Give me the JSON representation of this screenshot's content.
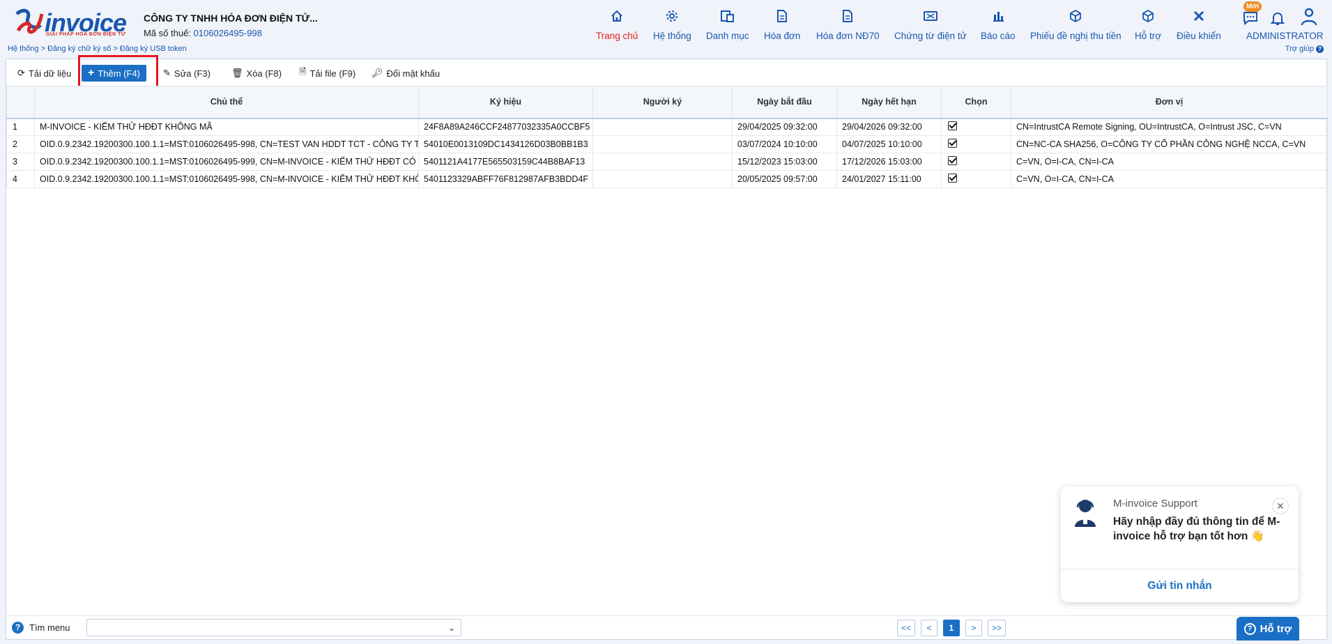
{
  "header": {
    "logo_text": "invoice",
    "logo_sub": "GIẢI PHÁP HÓA ĐƠN ĐIỆN TỬ",
    "company": "CÔNG TY TNHH HÓA ĐƠN ĐIỆN TỬ...",
    "tax_label": "Mã số thuế:",
    "tax_value": "0106026495-998",
    "breadcrumb": "Hệ thống > Đăng ký chữ ký số > Đăng ký USB token",
    "help": "Trợ giúp",
    "badge": "Mới",
    "user": "ADMINISTRATOR",
    "nav": [
      {
        "label": "Trang chủ",
        "icon": "home-icon"
      },
      {
        "label": "Hệ thống",
        "icon": "gear-icon"
      },
      {
        "label": "Danh mục",
        "icon": "catalog-icon"
      },
      {
        "label": "Hóa đơn",
        "icon": "invoice-icon"
      },
      {
        "label": "Hóa đơn NĐ70",
        "icon": "invoice-nd70-icon"
      },
      {
        "label": "Chứng từ điện tử",
        "icon": "voucher-icon"
      },
      {
        "label": "Báo cáo",
        "icon": "report-icon"
      },
      {
        "label": "Phiếu đề nghị thu tiền",
        "icon": "box-icon"
      },
      {
        "label": "Hỗ trợ",
        "icon": "box-icon"
      },
      {
        "label": "Điều khiển",
        "icon": "tools-icon"
      }
    ]
  },
  "toolbar": {
    "reload": "Tải dữ liệu",
    "add": "Thêm (F4)",
    "edit": "Sửa (F3)",
    "delete": "Xóa (F8)",
    "upload": "Tải file (F9)",
    "change_password": "Đổi mật khẩu"
  },
  "table": {
    "columns": [
      "Chủ thể",
      "Ký hiệu",
      "Người ký",
      "Ngày bắt đầu",
      "Ngày hết hạn",
      "Chọn",
      "Đơn vị"
    ],
    "rows": [
      {
        "no": "1",
        "subject": "M-INVOICE - KIỂM THỬ HĐĐT KHÔNG MÃ",
        "serial": "24F8A89A246CCF24877032335A0CCBF5",
        "signer": "",
        "start": "29/04/2025 09:32:00",
        "end": "29/04/2026 09:32:00",
        "checked": true,
        "unit": "CN=IntrustCA Remote Signing, OU=IntrustCA, O=Intrust JSC, C=VN"
      },
      {
        "no": "2",
        "subject": "OID.0.9.2342.19200300.100.1.1=MST:0106026495-998, CN=TEST VAN HDDT TCT - CÔNG TY TNHH",
        "serial": "54010E0013109DC1434126D03B0BB1B3",
        "signer": "",
        "start": "03/07/2024 10:10:00",
        "end": "04/07/2025 10:10:00",
        "checked": true,
        "unit": "CN=NC-CA SHA256, O=CÔNG TY CỔ PHẦN CÔNG NGHỆ NCCA, C=VN"
      },
      {
        "no": "3",
        "subject": "OID.0.9.2342.19200300.100.1.1=MST:0106026495-999, CN=M-INVOICE - KIỂM THỬ HĐĐT CÓ MÃ",
        "serial": "5401121A4177E565503159C44B8BAF13",
        "signer": "",
        "start": "15/12/2023 15:03:00",
        "end": "17/12/2026 15:03:00",
        "checked": true,
        "unit": "C=VN, O=I-CA, CN=I-CA"
      },
      {
        "no": "4",
        "subject": "OID.0.9.2342.19200300.100.1.1=MST:0106026495-998, CN=M-INVOICE - KIỂM THỬ HĐĐT KHÔNG MÃ",
        "serial": "5401123329ABFF76F812987AFB3BDD4F",
        "signer": "",
        "start": "20/05/2025 09:57:00",
        "end": "24/01/2027 15:11:00",
        "checked": true,
        "unit": "C=VN, O=I-CA, CN=I-CA"
      }
    ]
  },
  "footer": {
    "find_menu": "Tìm menu",
    "pager": [
      "<<",
      "<",
      "1",
      ">",
      ">>"
    ]
  },
  "chat": {
    "sender": "M-invoice Support",
    "message": "Hãy nhập đầy đủ thông tin để M-invoice hỗ trợ bạn tốt hơn 👋",
    "send": "Gửi tin nhắn",
    "support_button": "Hỗ trợ"
  },
  "colors": {
    "brand": "#1a56b0",
    "primary": "#1a6fc4",
    "active": "#e02020",
    "highlight": "#e8141c"
  }
}
